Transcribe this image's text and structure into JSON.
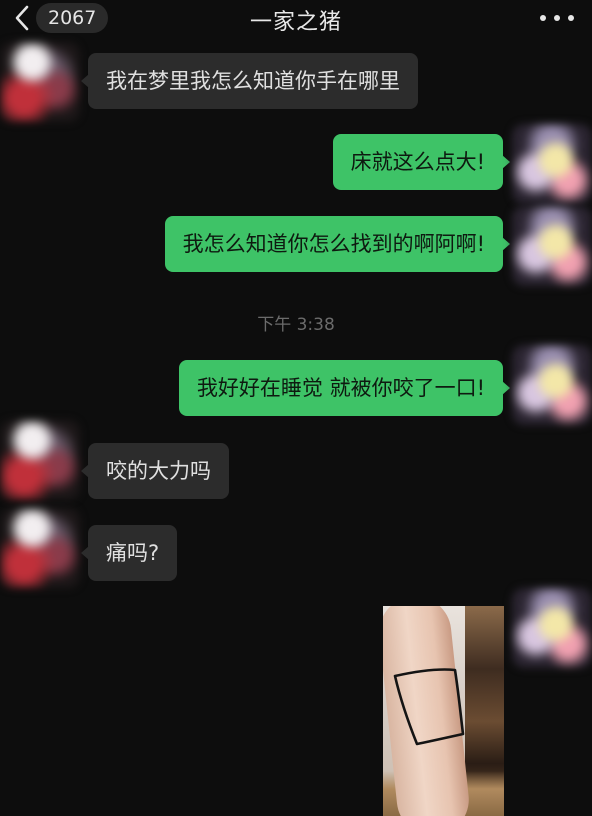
{
  "header": {
    "title": "一家之猪",
    "unread_count": "2067",
    "back_icon": "chevron-left-icon",
    "more_icon": "more-dots-icon"
  },
  "messages": [
    {
      "side": "in",
      "text": "我在梦里我怎么知道你手在哪里"
    },
    {
      "side": "out",
      "text": "床就这么点大!"
    },
    {
      "side": "out",
      "text": "我怎么知道你怎么找到的啊阿啊!"
    },
    {
      "side": "out",
      "text": "我好好在睡觉 就被你咬了一口!"
    },
    {
      "side": "in",
      "text": "咬的大力吗"
    },
    {
      "side": "in",
      "text": "痛吗?"
    }
  ],
  "timestamp": "下午 3:38",
  "colors": {
    "background": "#0d0d0d",
    "incoming_bubble": "#2c2c2c",
    "outgoing_bubble": "#3ec367",
    "timestamp_text": "#6b6b6b"
  }
}
